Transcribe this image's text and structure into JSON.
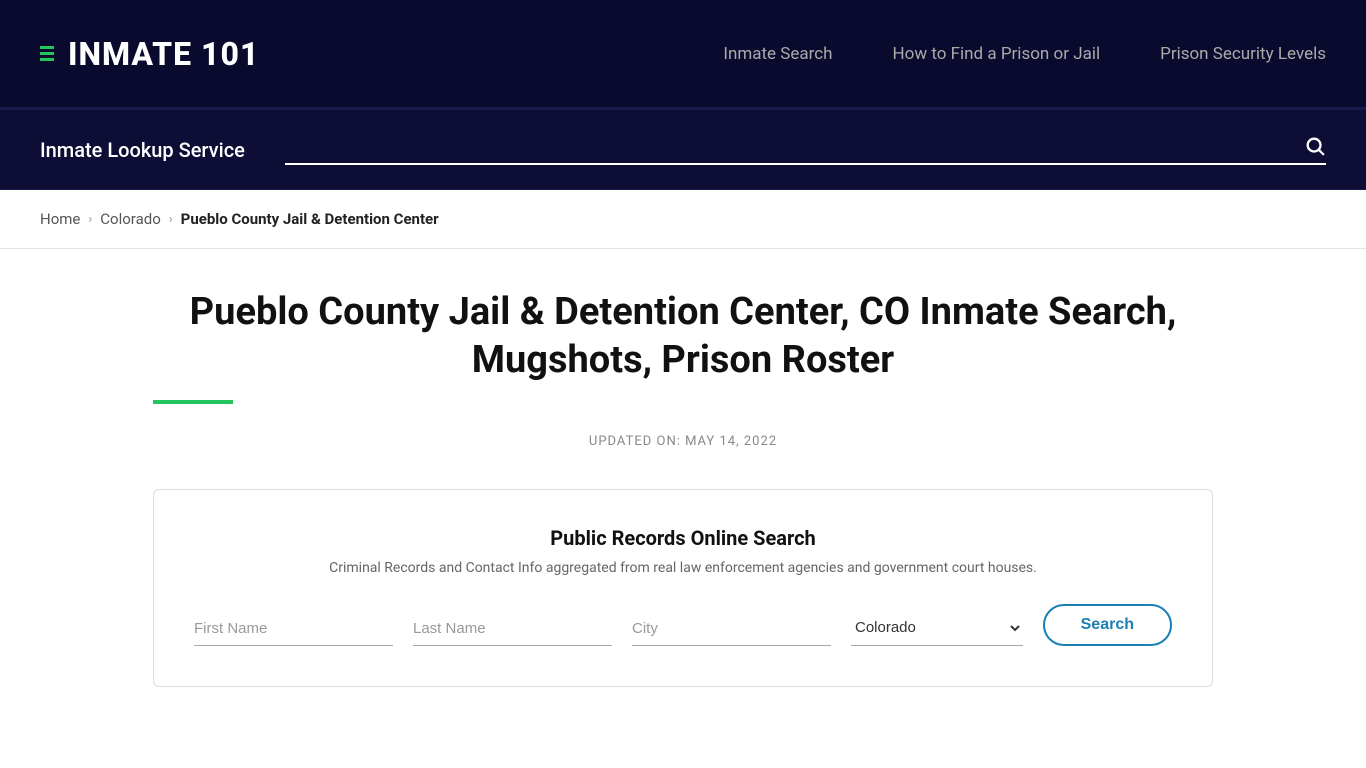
{
  "nav": {
    "logo_text": "INMATE 101",
    "links": [
      {
        "label": "Inmate Search",
        "name": "nav-inmate-search"
      },
      {
        "label": "How to Find a Prison or Jail",
        "name": "nav-how-to-find"
      },
      {
        "label": "Prison Security Levels",
        "name": "nav-prison-security"
      }
    ]
  },
  "search_bar": {
    "label": "Inmate Lookup Service",
    "placeholder": ""
  },
  "breadcrumb": {
    "home": "Home",
    "state": "Colorado",
    "current": "Pueblo County Jail & Detention Center"
  },
  "page": {
    "title": "Pueblo County Jail & Detention Center, CO Inmate Search, Mugshots, Prison Roster",
    "updated_label": "UPDATED ON: MAY 14, 2022"
  },
  "search_card": {
    "title": "Public Records Online Search",
    "subtitle": "Criminal Records and Contact Info aggregated from real law enforcement agencies and government court houses.",
    "first_name_placeholder": "First Name",
    "last_name_placeholder": "Last Name",
    "city_placeholder": "City",
    "state_default": "Colorado",
    "search_button_label": "Search"
  }
}
